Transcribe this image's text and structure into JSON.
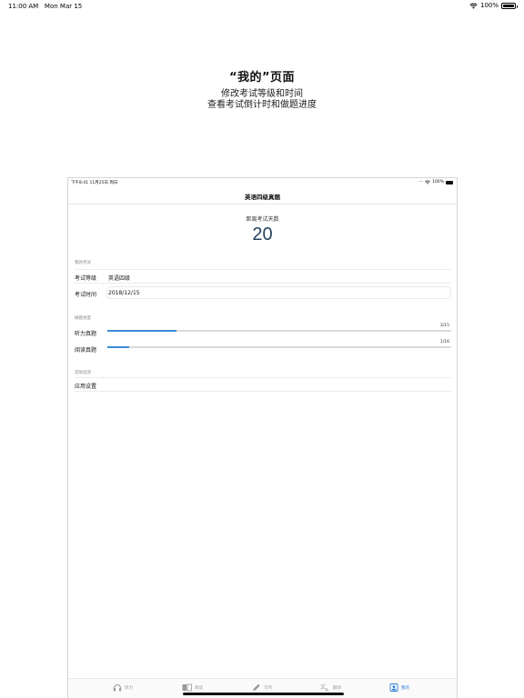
{
  "status_bar": {
    "time": "11:00 AM",
    "date": "Mon Mar 15",
    "battery": "100%"
  },
  "caption": {
    "title": "“我的”页面",
    "line1": "修改考试等级和时间",
    "line2": "查看考试倒计时和做题进度"
  },
  "device": {
    "status": {
      "left": "下午8:41  11月25日 周日",
      "battery": "100%"
    },
    "nav_title": "英语四级真题",
    "countdown": {
      "label": "距离考试天数",
      "value": "20"
    },
    "my_exam": {
      "header": "我的考试",
      "level_label": "考试等级",
      "level_value": "英语四级",
      "date_label": "考试时间",
      "date_value": "2018/12/15"
    },
    "progress": {
      "header": "做题进度",
      "items": [
        {
          "label": "听力真题",
          "count": "3/15",
          "fraction": 0.2
        },
        {
          "label": "阅读真题",
          "count": "1/16",
          "fraction": 0.0625
        }
      ]
    },
    "other": {
      "header": "其他选项",
      "settings_label": "应用设置"
    },
    "tabs": [
      {
        "label": "听力",
        "icon": "headphones-icon"
      },
      {
        "label": "阅读",
        "icon": "book-icon"
      },
      {
        "label": "写作",
        "icon": "pencil-icon"
      },
      {
        "label": "翻译",
        "icon": "translate-icon"
      },
      {
        "label": "我的",
        "icon": "profile-icon",
        "active": true
      }
    ],
    "accent_color": "#2b7fd9",
    "countdown_color": "#25425e"
  }
}
